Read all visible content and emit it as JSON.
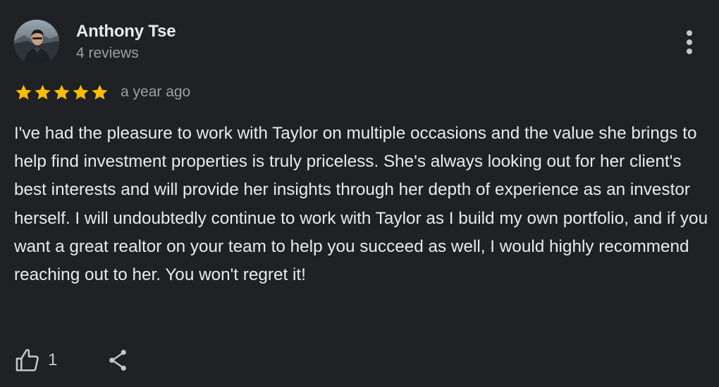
{
  "review": {
    "author": {
      "name": "Anthony Tse",
      "reviews_count": "4 reviews",
      "avatar_icon": "user-avatar-photo"
    },
    "rating": 5,
    "max_rating": 5,
    "time_ago": "a year ago",
    "text": "I've had the pleasure to work with Taylor on multiple occasions and the value she brings to help find investment properties is truly priceless. She's always looking out for her client's best interests and will provide her insights through her depth of experience as an investor herself. I will undoubtedly continue to work with Taylor as I build my own portfolio, and if you want a great realtor on your team to help you succeed as well, I would highly recommend reaching out to her. You won't regret it!",
    "likes": "1",
    "icons": {
      "more": "more-vert-icon",
      "like": "thumbs-up-icon",
      "share": "share-icon"
    }
  },
  "colors": {
    "background": "#202124",
    "primary_text": "#e8eaed",
    "secondary_text": "#9aa0a6",
    "star": "#fbbc04"
  }
}
